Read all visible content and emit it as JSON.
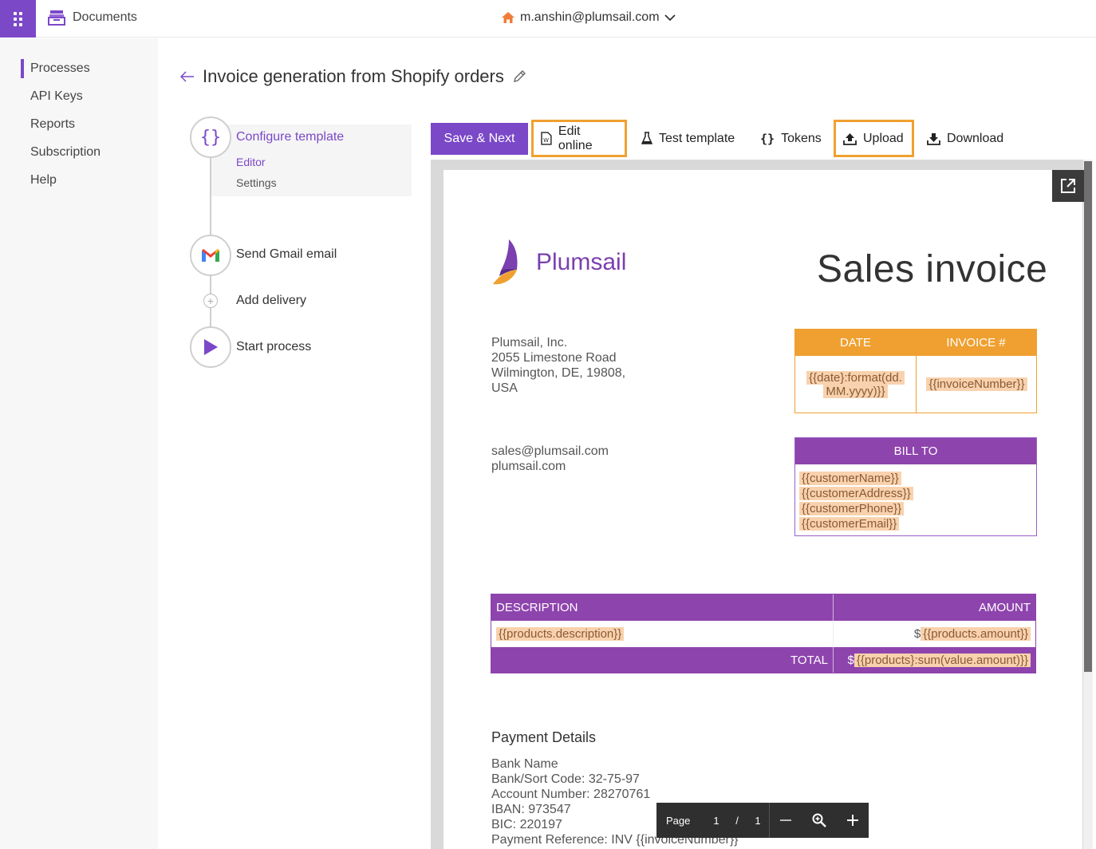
{
  "topbar": {
    "app_name": "Documents",
    "account": "m.anshin@plumsail.com"
  },
  "sidebar": {
    "items": [
      {
        "label": "Processes",
        "active": true
      },
      {
        "label": "API Keys"
      },
      {
        "label": "Reports"
      },
      {
        "label": "Subscription"
      },
      {
        "label": "Help"
      }
    ]
  },
  "page": {
    "title": "Invoice generation from Shopify orders"
  },
  "steps": {
    "configure": "Configure template",
    "editor": "Editor",
    "settings": "Settings",
    "gmail": "Send Gmail email",
    "add_delivery": "Add delivery",
    "start": "Start process"
  },
  "toolbar": {
    "save_next": "Save & Next",
    "edit_online": "Edit online",
    "test_template": "Test template",
    "tokens": "Tokens",
    "upload": "Upload",
    "download": "Download"
  },
  "invoice": {
    "logo_text": "Plumsail",
    "title": "Sales invoice",
    "address": [
      "Plumsail, Inc.",
      "2055 Limestone Road",
      "Wilmington, DE, 19808,",
      "USA"
    ],
    "contact": [
      "sales@plumsail.com",
      "plumsail.com"
    ],
    "date_header": "DATE",
    "invoice_no_header": "INVOICE #",
    "date_token_1": "{{date}:format(dd.",
    "date_token_2": "MM.yyyy)}}",
    "invoice_token": "{{invoiceNumber}}",
    "bill_to": "BILL TO",
    "bill_tokens": [
      "{{customerName}}",
      "{{customerAddress}}",
      "{{customerPhone}}",
      "{{customerEmail}}"
    ],
    "desc_header": "DESCRIPTION",
    "amount_header": "AMOUNT",
    "desc_token": "{{products.description}}",
    "amount_prefix": "$",
    "amount_token": "{{products.amount}}",
    "total_label": "TOTAL",
    "total_prefix": "$",
    "total_token": "{{products}:sum(value.amount)}}",
    "payment_title": "Payment Details",
    "payment_lines": [
      "Bank Name",
      "Bank/Sort Code: 32-75-97",
      "Account Number: 28270761",
      "IBAN: 973547",
      "BIC: 220197",
      "Payment Reference: INV {{invoiceNumber}}"
    ]
  },
  "pager": {
    "page_label": "Page",
    "current": "1",
    "separator": "/",
    "total": "1"
  }
}
